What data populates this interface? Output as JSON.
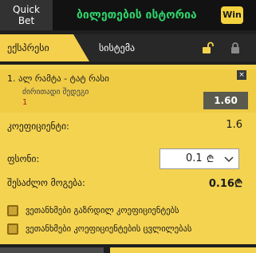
{
  "header": {
    "quick_bet_line1": "Quick",
    "quick_bet_line2": "Bet",
    "history_title": "ბილეთების ისტორია",
    "win_badge": "Win"
  },
  "tabs": {
    "express": "ექსპრესი",
    "system": "სისტემა"
  },
  "bet": {
    "event": "1. ალ რამტა - ტატ რასი",
    "market": "ძირითადი შედეგი",
    "outcome": "1",
    "odds": "1.60",
    "close_symbol": "×"
  },
  "summary": {
    "coefficient_label": "კოეფიციენტი:",
    "coefficient_value": "1.6",
    "stake_label": "ფსონი:",
    "stake_value": "0.1",
    "currency": "₾",
    "possible_win_label": "შესაძლო მოგება:",
    "possible_win_value": "0.16₾"
  },
  "options": {
    "accept_higher_odds": "ვეთანხმები გაზრდილ კოეფიციენტებს",
    "accept_odds_change": "ვეთანხმები კოეფიციენტების ცვლილებას"
  },
  "icons": {
    "lock_open": "lock-open-icon",
    "lock": "lock-icon",
    "chevron": "chevron-down-icon"
  },
  "colors": {
    "accent_yellow": "#f4d350",
    "green_title": "#2ed36a",
    "dark_bg": "#121212"
  }
}
